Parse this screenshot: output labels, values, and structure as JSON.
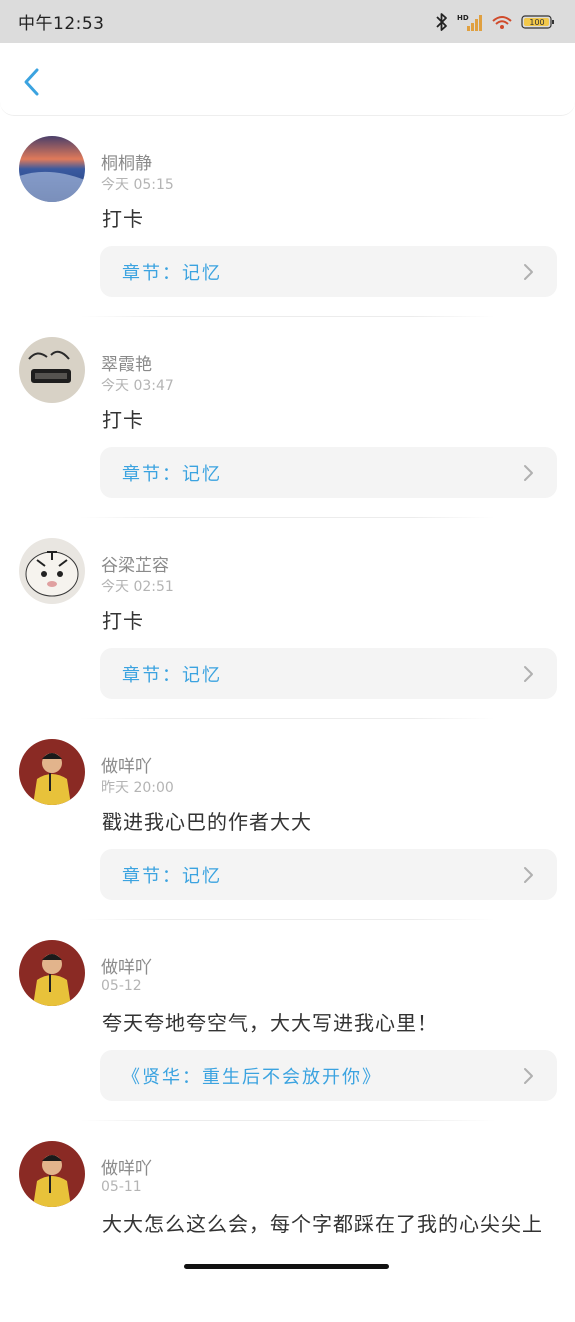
{
  "status_bar": {
    "time": "中午12:53",
    "battery": "100"
  },
  "feed": [
    {
      "name": "桐桐静",
      "time": "今天 05:15",
      "content": "打卡",
      "chapter": "章节：记忆"
    },
    {
      "name": "翠霞艳",
      "time": "今天 03:47",
      "content": "打卡",
      "chapter": "章节：记忆"
    },
    {
      "name": "谷梁芷容",
      "time": "今天 02:51",
      "content": "打卡",
      "chapter": "章节：记忆"
    },
    {
      "name": "做咩吖",
      "time": "昨天 20:00",
      "content": "戳进我心巴的作者大大",
      "chapter": "章节：记忆"
    },
    {
      "name": "做咩吖",
      "time": "05-12",
      "content": "夸天夸地夸空气，大大写进我心里！",
      "chapter": "《贤华：重生后不会放开你》"
    },
    {
      "name": "做咩吖",
      "time": "05-11",
      "content": "大大怎么这么会，每个字都踩在了我的心尖尖上"
    }
  ],
  "colors": {
    "accent": "#3ba3e0",
    "card_bg": "#f4f4f4",
    "status_bg": "#dcdcdc"
  }
}
